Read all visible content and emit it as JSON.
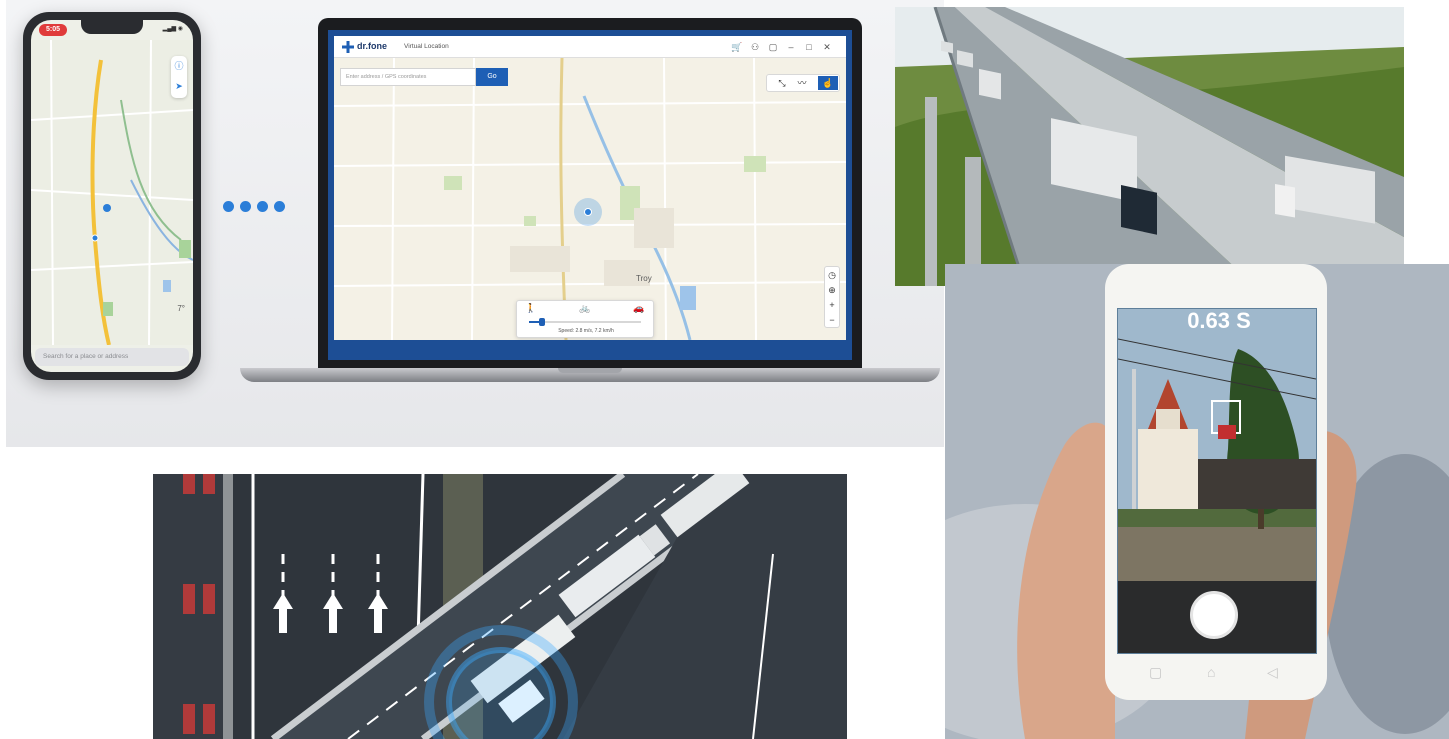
{
  "hero": {
    "phone": {
      "time": "5:05",
      "weather": "7°",
      "search_placeholder": "Search for a place or address"
    },
    "laptop": {
      "brand": "dr.fone",
      "app_title": "Virtual Location",
      "search_placeholder": "Enter address / GPS coordinates",
      "go_label": "Go",
      "speed_label": "Speed: 2.8 m/s, 7.2 km/h",
      "map_city": "Troy",
      "speed_fraction": 0.12
    },
    "dot_color": "#2b7ed8",
    "icons": [
      "walk-icon",
      "bike-icon",
      "car-icon",
      "cart-icon",
      "user-icon",
      "chat-icon",
      "minimize-icon",
      "maximize-icon",
      "close-icon",
      "teleport-icon",
      "multi-stop-icon",
      "one-stop-icon",
      "history-icon",
      "locate-icon",
      "zoom-in-icon",
      "zoom-out-icon"
    ]
  },
  "camera_phone": {
    "overlay_text": "0.63 S"
  },
  "colors": {
    "accent": "#1e5fb5",
    "pin": "#2b7ed8",
    "status_red": "#e03b3b"
  }
}
